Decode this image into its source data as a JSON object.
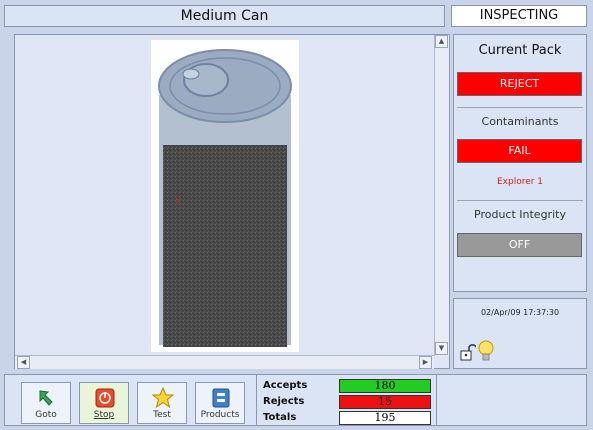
{
  "header": {
    "title": "Medium Can",
    "status": "INSPECTING"
  },
  "right_panel": {
    "title": "Current Pack",
    "result": {
      "label": "REJECT",
      "color": "#ff0000"
    },
    "contaminants": {
      "label": "Contaminants",
      "status": "FAIL",
      "color": "#ff0000",
      "detector": "Explorer 1"
    },
    "product_integrity": {
      "label": "Product Integrity",
      "status": "OFF",
      "color": "#999999"
    }
  },
  "datetime": "02/Apr/09 17:37:30",
  "toolbar": {
    "goto": "Goto",
    "stop": "Stop",
    "test": "Test",
    "products": "Products"
  },
  "stats": {
    "accepts_label": "Accepts",
    "accepts_value": "180",
    "accepts_color": "#22cc22",
    "rejects_label": "Rejects",
    "rejects_value": "15",
    "rejects_color": "#ee1111",
    "totals_label": "Totals",
    "totals_value": "195"
  },
  "icons": [
    "up-arrow-icon",
    "down-arrow-icon",
    "left-arrow-icon",
    "right-arrow-icon",
    "lock-icon",
    "lightbulb-icon",
    "goto-arrow-icon",
    "stop-icon",
    "star-icon",
    "products-icon",
    "contaminant-marker-icon"
  ]
}
